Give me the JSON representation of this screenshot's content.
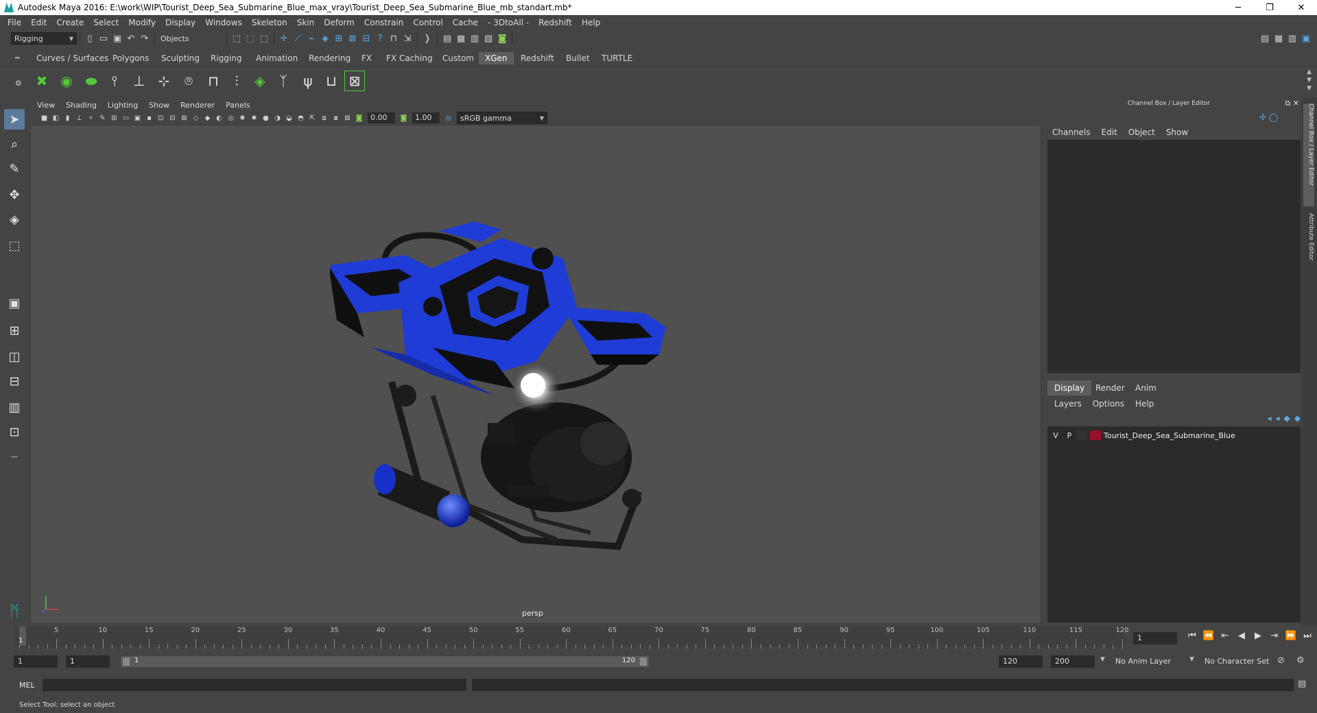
{
  "window": {
    "title": "Autodesk Maya 2016: E:\\work\\WIP\\Tourist_Deep_Sea_Submarine_Blue_max_vray\\Tourist_Deep_Sea_Submarine_Blue_mb_standart.mb*",
    "min": "─",
    "restore": "❐",
    "close": "✕"
  },
  "menubar": [
    "File",
    "Edit",
    "Create",
    "Select",
    "Modify",
    "Display",
    "Windows",
    "Skeleton",
    "Skin",
    "Deform",
    "Constrain",
    "Control",
    "Cache",
    "- 3DtoAll -",
    "Redshift",
    "Help"
  ],
  "statusline": {
    "menuset": "Rigging",
    "selection_mode": "Objects"
  },
  "shelf": {
    "tabs": [
      "Curves / Surfaces",
      "Polygons",
      "Sculpting",
      "Rigging",
      "Animation",
      "Rendering",
      "FX",
      "FX Caching",
      "Custom",
      "XGen",
      "Redshift",
      "Bullet",
      "TURTLE"
    ],
    "active_tab": "XGen"
  },
  "viewport": {
    "menus": [
      "View",
      "Shading",
      "Lighting",
      "Show",
      "Renderer",
      "Panels"
    ],
    "exposure": "0.00",
    "gamma": "1.00",
    "color_space": "sRGB gamma",
    "camera": "persp"
  },
  "right_panel": {
    "title": "Channel Box / Layer Editor",
    "channel_menu": [
      "Channels",
      "Edit",
      "Object",
      "Show"
    ],
    "layer_tabs": [
      "Display",
      "Render",
      "Anim"
    ],
    "active_layer_tab": "Display",
    "layer_menu": [
      "Layers",
      "Options",
      "Help"
    ],
    "layers": [
      {
        "v": "V",
        "p": "P",
        "name": "Tourist_Deep_Sea_Submarine_Blue",
        "color": "#9a0f2e"
      }
    ],
    "side_tabs": [
      "Channel Box / Layer Editor",
      "Attribute Editor"
    ]
  },
  "timeslider": {
    "labels": [
      "5",
      "10",
      "15",
      "20",
      "25",
      "30",
      "35",
      "40",
      "45",
      "50",
      "55",
      "60",
      "65",
      "70",
      "75",
      "80",
      "85",
      "90",
      "95",
      "100",
      "105",
      "110",
      "115",
      "120"
    ],
    "current_frame": "1",
    "frame_field": "1"
  },
  "range": {
    "start": "1",
    "playback_start": "1",
    "slider_start": "1",
    "slider_end": "120",
    "playback_end": "120",
    "end": "200",
    "anim_layer": "No Anim Layer",
    "character_set": "No Character Set"
  },
  "mel": {
    "label": "MEL"
  },
  "help_line": "Select Tool: select an object",
  "colors": {
    "accent": "#5c7a9a",
    "submarine_blue": "#1f3cd6",
    "layer_color": "#9a0f2e"
  }
}
